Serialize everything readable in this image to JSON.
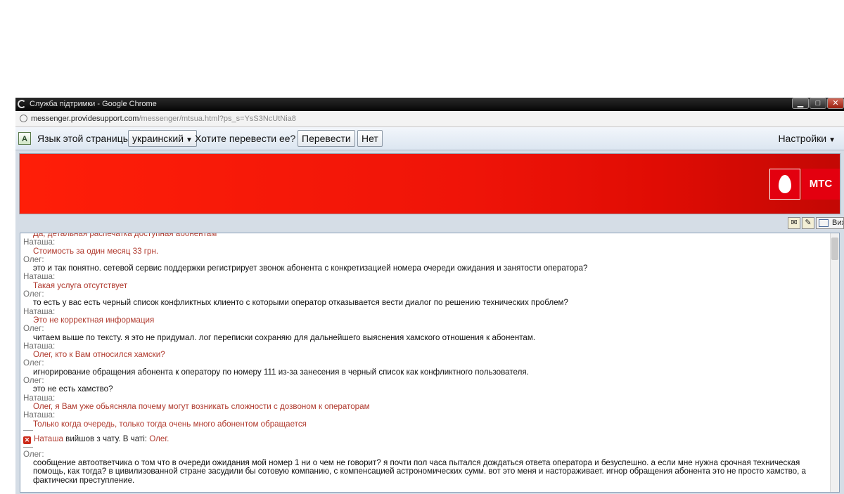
{
  "window": {
    "title": "Служба підтримки - Google Chrome",
    "controls": {
      "minimize": "▁",
      "maximize": "□",
      "close": "✕"
    }
  },
  "address": {
    "url_host": "messenger.providesupport.com",
    "url_rest": "/messenger/mtsua.html?ps_s=YsS3NcUtNia8"
  },
  "translate_bar": {
    "prefix": "Язык этой страницы",
    "language": "украинский",
    "question": "Хотите перевести ее?",
    "translate_button": "Перевести",
    "no_button": "Нет",
    "settings": "Настройки"
  },
  "banner": {
    "logo_text": "МТС",
    "accent": "#e3000f"
  },
  "toolbar": {
    "exit_label": "Вихід"
  },
  "chat": {
    "partial_first": "Да, детальная распечатка доступная абонентам",
    "messages": [
      {
        "speaker": "Наташа:",
        "text": "Стоимость за один месяц 33 грн."
      },
      {
        "speaker": "Олег:",
        "text": "это и так понятно. сетевой сервис поддержки регистрирует звонок абонента с конкретизацией номера очереди ожидания и занятости оператора?"
      },
      {
        "speaker": "Наташа:",
        "text": "Такая услуга отсутствует"
      },
      {
        "speaker": "Олег:",
        "text": "то есть у вас есть черный список конфликтных клиенто с которыми оператор отказывается вести диалог по решению технических проблем?"
      },
      {
        "speaker": "Наташа:",
        "text": "Это не корректная информация"
      },
      {
        "speaker": "Олег:",
        "text": "читаем выше по тексту. я это не придумал. лог переписки сохраняю для дальнейшего выяснения хамского отношения к абонентам."
      },
      {
        "speaker": "Наташа:",
        "text": "Олег, кто к Вам относился хамски?"
      },
      {
        "speaker": "Олег:",
        "text": "игнорирование обращения абонента к оператору по номеру 111 из-за занесения в черный список как конфликтного пользователя."
      },
      {
        "speaker": "Олег:",
        "text": "это не есть хамство?"
      },
      {
        "speaker": "Наташа:",
        "text": "Олег, я Вам уже обьясняла почему могут возникать сложности с дозвоном к операторам"
      },
      {
        "speaker": "Наташа:",
        "text": "Только когда очередь, только тогда очень много абонентом обращается"
      }
    ],
    "system": {
      "name": "Наташа",
      "text": " вийшов з чату. В чаті: ",
      "in_chat": "Олег."
    },
    "last": {
      "speaker": "Олег:",
      "text": "сообщение автоответчика о том что в очереди ожидания мой номер 1 ни о чем не говорит? я почти пол часа пытался дождаться ответа оператора и безуспешно. а если мне нужна срочная техническая помощь, как тогда? в цивилизованной стране засудили бы сотовую компанию, с компенсацией астрономических сумм. вот это меня и настораживает. игнор обращения абонента это не просто хамство, а фактически преступление."
    }
  }
}
